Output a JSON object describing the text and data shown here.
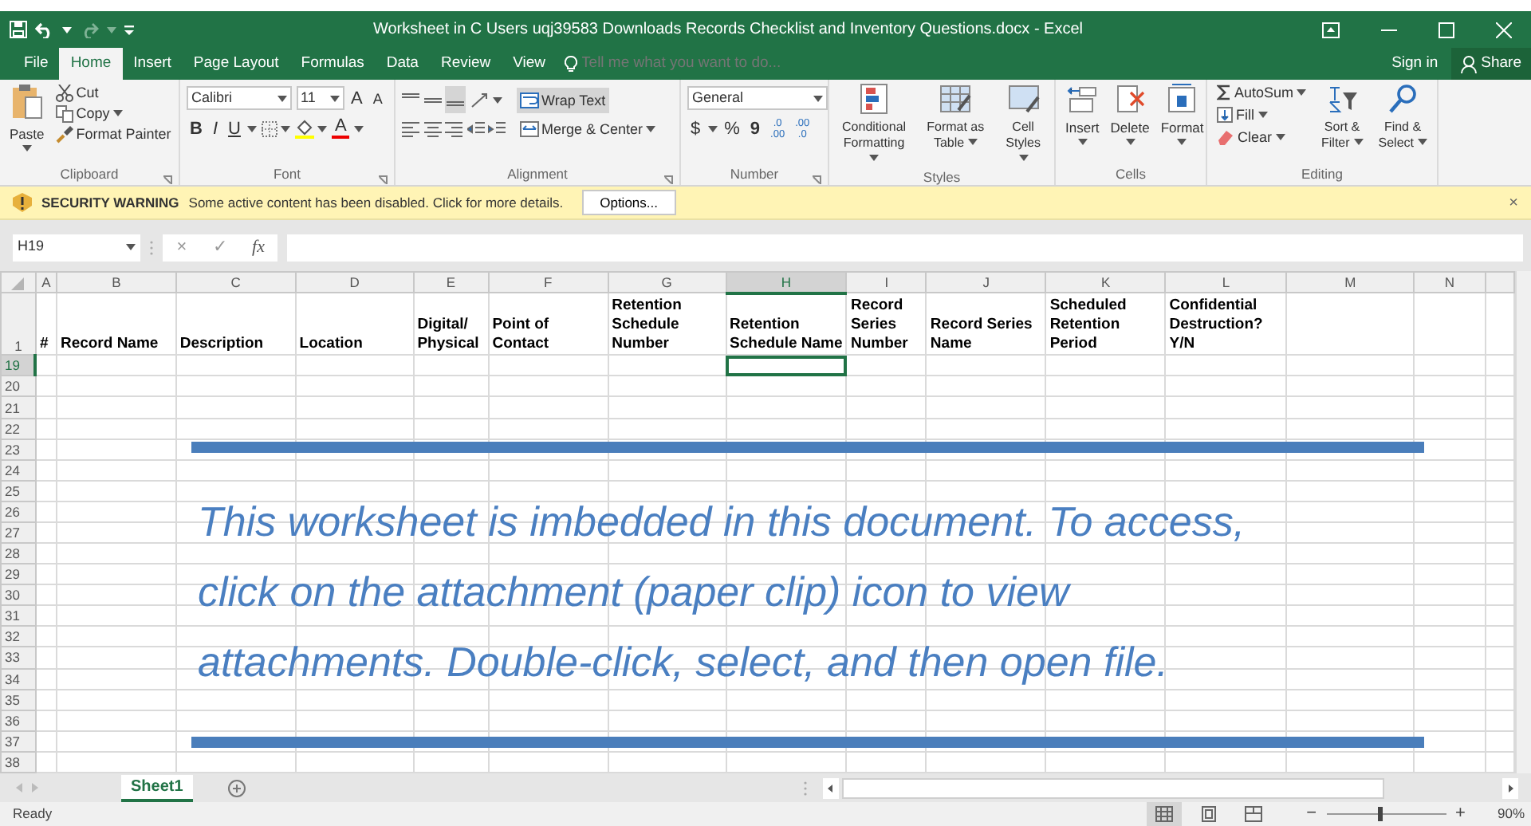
{
  "window": {
    "title": "Worksheet in C  Users uqj39583 Downloads Records Checklist and Inventory Questions.docx - Excel"
  },
  "menu_tabs": [
    {
      "label": "File",
      "selected": false
    },
    {
      "label": "Home",
      "selected": true
    },
    {
      "label": "Insert",
      "selected": false
    },
    {
      "label": "Page Layout",
      "selected": false
    },
    {
      "label": "Formulas",
      "selected": false
    },
    {
      "label": "Data",
      "selected": false
    },
    {
      "label": "Review",
      "selected": false
    },
    {
      "label": "View",
      "selected": false
    }
  ],
  "tell_me": {
    "placeholder": "Tell me what you want to do..."
  },
  "account": {
    "sign_in": "Sign in",
    "share": "Share"
  },
  "ribbon": {
    "clipboard": {
      "label": "Clipboard",
      "paste": "Paste",
      "cut": "Cut",
      "copy": "Copy",
      "format_painter": "Format Painter"
    },
    "font": {
      "label": "Font",
      "font_name": "Calibri",
      "font_size": "11",
      "grow": "A",
      "shrink": "A",
      "styles": [
        "B",
        "I",
        "U"
      ],
      "font_color": "A"
    },
    "alignment": {
      "label": "Alignment",
      "wrap_text": "Wrap Text",
      "wrap_on": true,
      "merge": "Merge & Center"
    },
    "number": {
      "label": "Number",
      "format": "General",
      "symbols": [
        "$",
        "%",
        "9"
      ],
      "decimals": [
        [
          ".0",
          ".00"
        ],
        [
          ".00",
          ".0"
        ]
      ]
    },
    "styles": {
      "label": "Styles",
      "buttons": [
        "Conditional Formatting",
        "Format as Table",
        "Cell Styles"
      ]
    },
    "cells": {
      "label": "Cells",
      "buttons": [
        "Insert",
        "Delete",
        "Format"
      ]
    },
    "editing": {
      "label": "Editing",
      "autosum": "AutoSum",
      "fill": "Fill",
      "clear": "Clear",
      "buttons": [
        "Sort & Filter",
        "Find & Select"
      ]
    }
  },
  "security": {
    "title": "SECURITY WARNING",
    "message": "Some active content has been disabled. Click for more details.",
    "button": "Options...",
    "close": "×"
  },
  "formula_bar": {
    "name_box": "H19",
    "cancel": "×",
    "enter": "✓",
    "fx": "fx"
  },
  "columns": [
    {
      "letter": "A",
      "selected": false
    },
    {
      "letter": "B",
      "selected": false
    },
    {
      "letter": "C",
      "selected": false
    },
    {
      "letter": "D",
      "selected": false
    },
    {
      "letter": "E",
      "selected": false
    },
    {
      "letter": "F",
      "selected": false
    },
    {
      "letter": "G",
      "selected": false
    },
    {
      "letter": "H",
      "selected": true
    },
    {
      "letter": "I",
      "selected": false
    },
    {
      "letter": "J",
      "selected": false
    },
    {
      "letter": "K",
      "selected": false
    },
    {
      "letter": "L",
      "selected": false
    },
    {
      "letter": "M",
      "selected": false
    },
    {
      "letter": "N",
      "selected": false
    }
  ],
  "header_row": {
    "number": "1",
    "cells": [
      "#",
      "Record Name",
      "Description",
      "Location",
      "Digital/ Physical",
      "Point of Contact",
      "Retention Schedule Number",
      "Retention Schedule Name",
      "Record Series Number",
      "Record Series Name",
      "Scheduled Retention Period",
      "Confidential Destruction? Y/N"
    ]
  },
  "rows": [
    {
      "number": "19",
      "selected": true
    },
    {
      "number": "20",
      "selected": false
    },
    {
      "number": "21",
      "selected": false
    },
    {
      "number": "22",
      "selected": false
    },
    {
      "number": "23",
      "selected": false
    },
    {
      "number": "24",
      "selected": false
    },
    {
      "number": "25",
      "selected": false
    },
    {
      "number": "26",
      "selected": false
    },
    {
      "number": "27",
      "selected": false
    },
    {
      "number": "28",
      "selected": false
    },
    {
      "number": "29",
      "selected": false
    },
    {
      "number": "30",
      "selected": false
    },
    {
      "number": "31",
      "selected": false
    },
    {
      "number": "32",
      "selected": false
    },
    {
      "number": "33",
      "selected": false
    },
    {
      "number": "34",
      "selected": false
    },
    {
      "number": "35",
      "selected": false
    },
    {
      "number": "36",
      "selected": false
    },
    {
      "number": "37",
      "selected": false
    },
    {
      "number": "38",
      "selected": false
    }
  ],
  "note": {
    "lines": [
      "This worksheet is imbedded in this document. To access,",
      "click on the attachment (paper clip) icon to view",
      "attachments. Double-click, select, and then open file."
    ]
  },
  "sheet_tabs": [
    {
      "label": "Sheet1",
      "selected": true
    }
  ],
  "status_bar": {
    "text": "Ready",
    "zoom": "90%",
    "zoom_slider": {
      "level": 0.45
    },
    "views": [
      {
        "kind": "normal",
        "selected": true
      },
      {
        "kind": "page-layout",
        "selected": false
      },
      {
        "kind": "page-break",
        "selected": false
      }
    ],
    "minus": "−",
    "plus": "+"
  }
}
